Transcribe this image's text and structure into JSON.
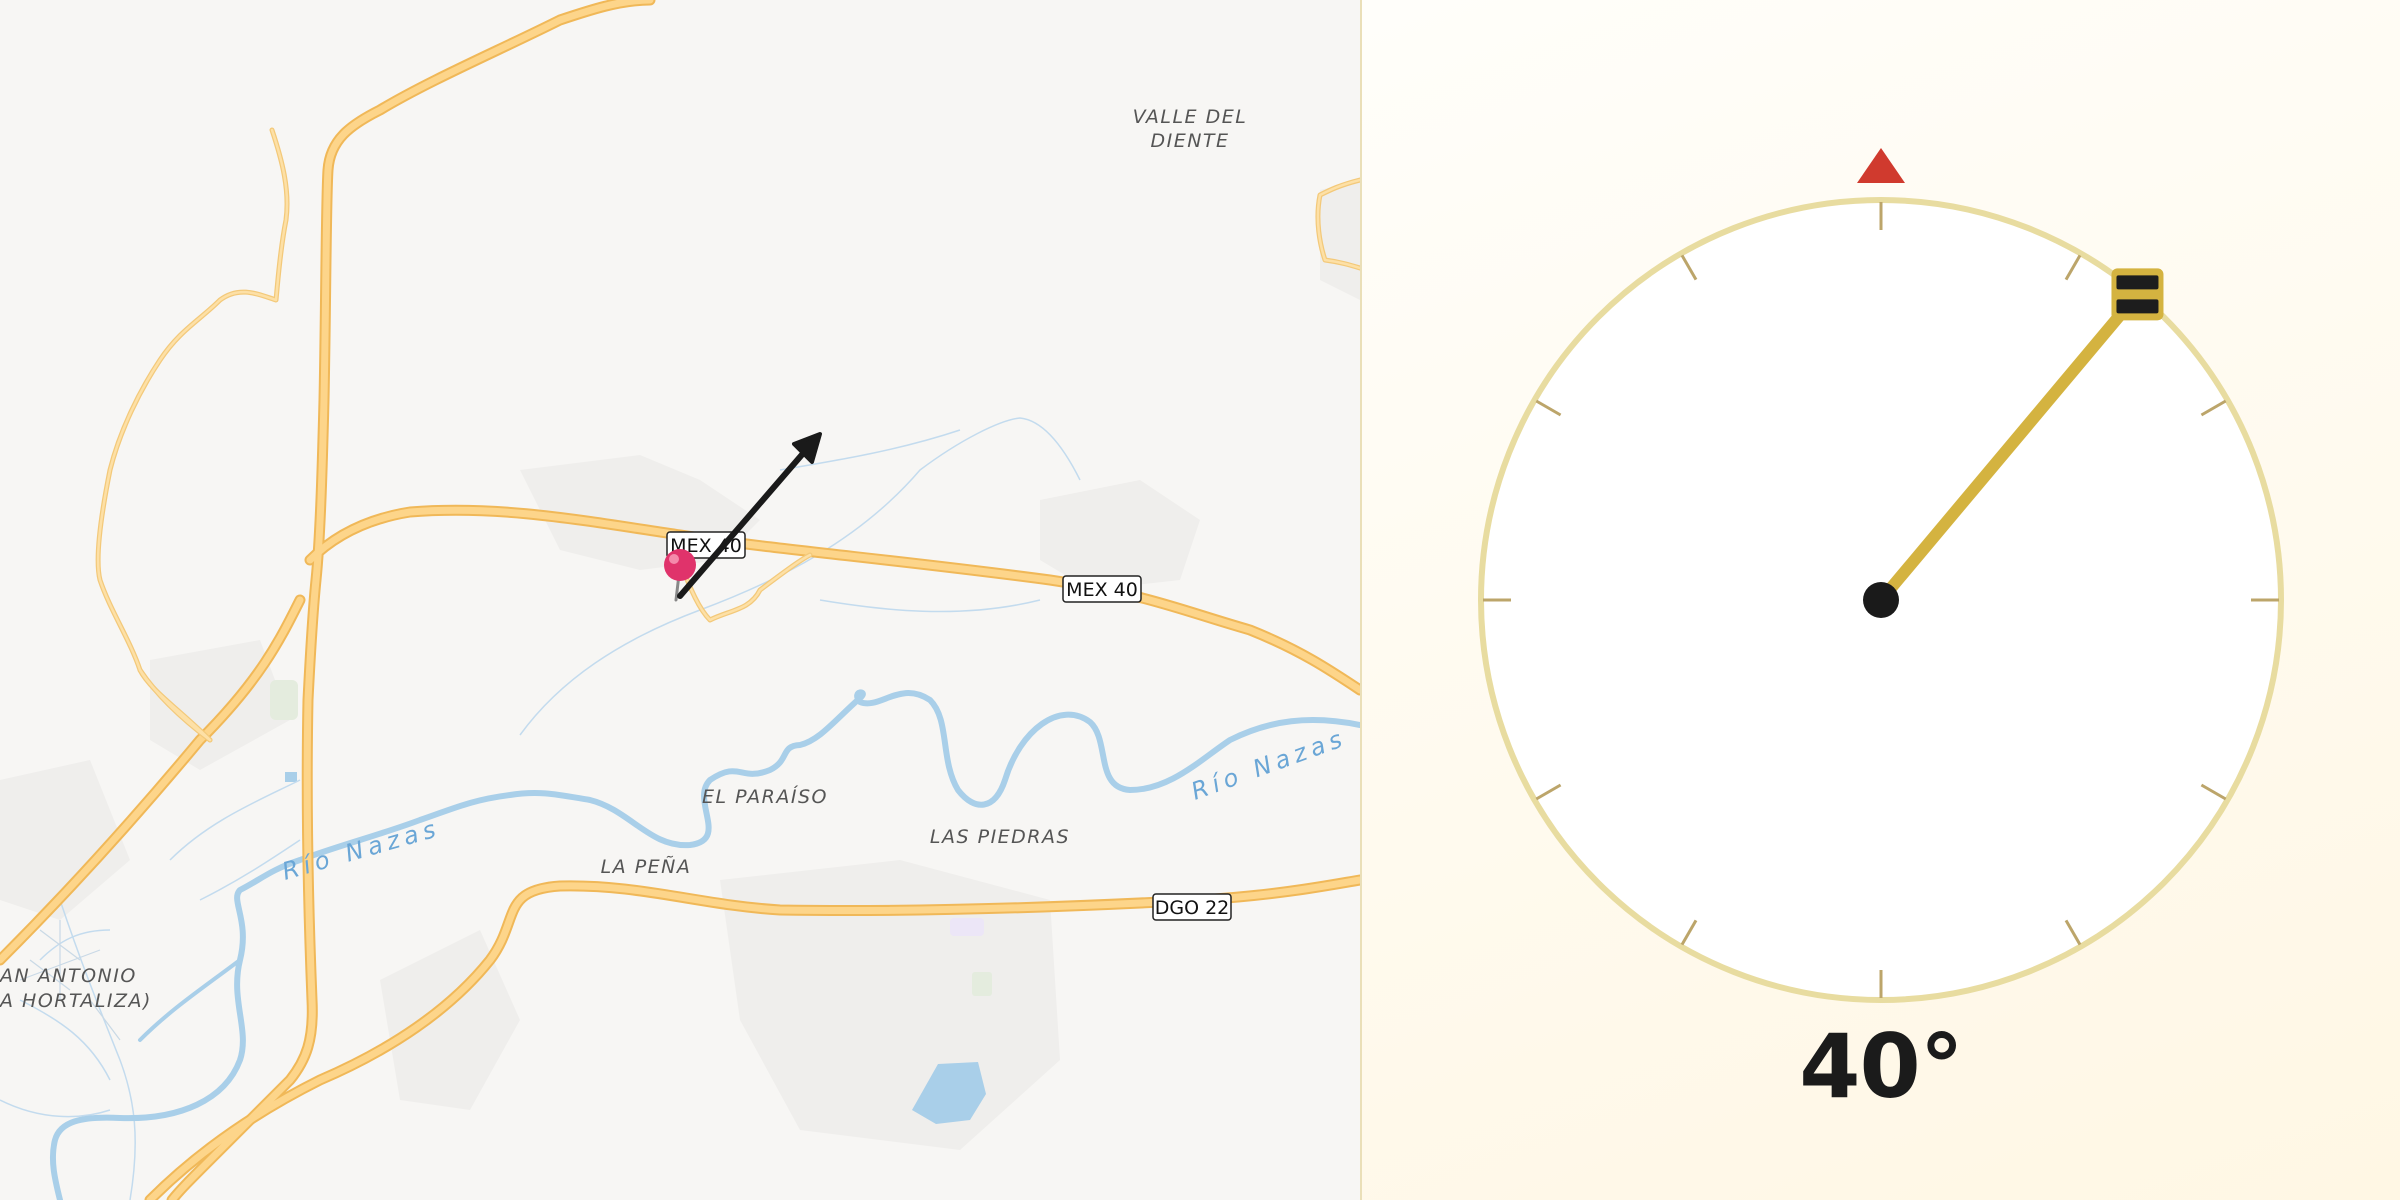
{
  "map": {
    "place_labels": {
      "valle_del_diente_line1": "VALLE DEL",
      "valle_del_diente_line2": "DIENTE",
      "el_paraiso": "EL PARAÍSO",
      "las_piedras": "LAS PIEDRAS",
      "la_pena": "LA PEÑA",
      "san_antonio_line1": "AN ANTONIO",
      "san_antonio_line2": "A HORTALIZA)"
    },
    "river_labels": {
      "west": "Río Nazas",
      "east": "Río Nazas"
    },
    "road_shields": {
      "mex40_west": "MEX 40",
      "mex40_east": "MEX 40",
      "dgo22": "DGO 22"
    },
    "marker_icon": "pin-icon",
    "direction_arrow_icon": "arrow-icon",
    "colors": {
      "road": "#fdd58a",
      "road_casing": "#f0b858",
      "river": "#a9cfe9",
      "pin": "#e0336b"
    }
  },
  "compass": {
    "heading_deg": 40,
    "heading_label": "40°",
    "north_marker_icon": "north-triangle-icon",
    "colors": {
      "ring": "#e8dca0",
      "needle": "#d4b340",
      "north_marker": "#d03a2e",
      "ticks": "#bca56a"
    }
  }
}
